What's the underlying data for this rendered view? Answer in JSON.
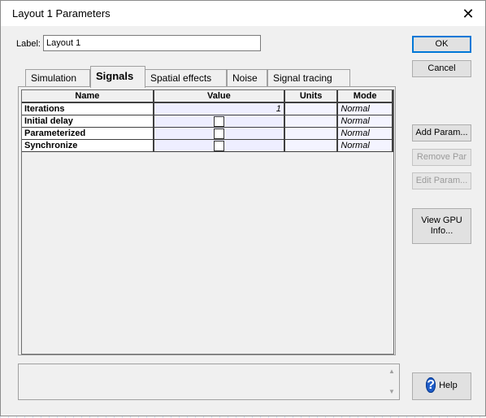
{
  "window": {
    "title": "Layout 1 Parameters",
    "close_glyph": "✕"
  },
  "label_field": {
    "label": "Label:",
    "value": "Layout 1"
  },
  "buttons": {
    "ok": "OK",
    "cancel": "Cancel",
    "add_param": "Add Param...",
    "remove_par": "Remove Par",
    "edit_param": "Edit Param...",
    "view_gpu_line1": "View GPU",
    "view_gpu_line2": "Info...",
    "help": "Help"
  },
  "tabs": [
    {
      "label": "Simulation",
      "active": false
    },
    {
      "label": "Signals",
      "active": true
    },
    {
      "label": "Spatial effects",
      "active": false
    },
    {
      "label": "Noise",
      "active": false
    },
    {
      "label": "Signal tracing",
      "active": false
    }
  ],
  "table": {
    "columns": [
      "Name",
      "Value",
      "Units",
      "Mode"
    ],
    "rows": [
      {
        "name": "Iterations",
        "value": "1",
        "units": "",
        "mode": "Normal",
        "checkbox": false
      },
      {
        "name": "Initial delay",
        "value": "",
        "units": "",
        "mode": "Normal",
        "checkbox": true
      },
      {
        "name": "Parameterized",
        "value": "",
        "units": "",
        "mode": "Normal",
        "checkbox": true
      },
      {
        "name": "Synchronize",
        "value": "",
        "units": "",
        "mode": "Normal",
        "checkbox": true
      }
    ]
  },
  "scroll": {
    "up": "▲",
    "down": "▼"
  },
  "icons": {
    "help": "?"
  }
}
